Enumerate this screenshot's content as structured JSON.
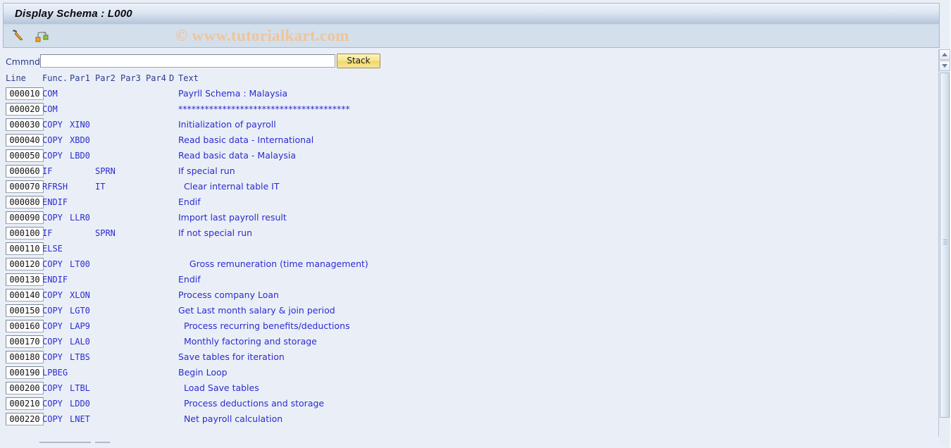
{
  "window": {
    "title": "Display Schema : L000"
  },
  "toolbar": {
    "icons": [
      {
        "name": "edit-pencil-icon",
        "label": "Display <-> Change"
      },
      {
        "name": "schema-structure-icon",
        "label": "Structure Display"
      }
    ]
  },
  "watermark": {
    "text": "© www.tutorialkart.com"
  },
  "command": {
    "label": "Cmmnd",
    "value": "",
    "placeholder": "",
    "stack_button": "Stack"
  },
  "table": {
    "headers": {
      "line": "Line",
      "func": "Func.",
      "par1": "Par1",
      "par2": "Par2",
      "par3": "Par3",
      "par4": "Par4",
      "d": "D",
      "text": "Text"
    },
    "rows": [
      {
        "line": "000010",
        "func": "COM",
        "par1": "",
        "par2": "",
        "par3": "",
        "par4": "",
        "d": "",
        "text": "Payrll Schema : Malaysia"
      },
      {
        "line": "000020",
        "func": "COM",
        "par1": "",
        "par2": "",
        "par3": "",
        "par4": "",
        "d": "",
        "text": "***************************************"
      },
      {
        "line": "000030",
        "func": "COPY",
        "par1": "XIN0",
        "par2": "",
        "par3": "",
        "par4": "",
        "d": "",
        "text": "Initialization of payroll"
      },
      {
        "line": "000040",
        "func": "COPY",
        "par1": "XBD0",
        "par2": "",
        "par3": "",
        "par4": "",
        "d": "",
        "text": "Read basic data - International"
      },
      {
        "line": "000050",
        "func": "COPY",
        "par1": "LBD0",
        "par2": "",
        "par3": "",
        "par4": "",
        "d": "",
        "text": "Read basic data - Malaysia"
      },
      {
        "line": "000060",
        "func": "IF",
        "par1": "",
        "par2": "SPRN",
        "par3": "",
        "par4": "",
        "d": "",
        "text": "If special run"
      },
      {
        "line": "000070",
        "func": "RFRSH",
        "par1": "",
        "par2": "IT",
        "par3": "",
        "par4": "",
        "d": "",
        "text": "  Clear internal table IT"
      },
      {
        "line": "000080",
        "func": "ENDIF",
        "par1": "",
        "par2": "",
        "par3": "",
        "par4": "",
        "d": "",
        "text": "Endif"
      },
      {
        "line": "000090",
        "func": "COPY",
        "par1": "LLR0",
        "par2": "",
        "par3": "",
        "par4": "",
        "d": "",
        "text": "Import last payroll result"
      },
      {
        "line": "000100",
        "func": "IF",
        "par1": "",
        "par2": "SPRN",
        "par3": "",
        "par4": "",
        "d": "",
        "text": "If not special run"
      },
      {
        "line": "000110",
        "func": "ELSE",
        "par1": "",
        "par2": "",
        "par3": "",
        "par4": "",
        "d": "",
        "text": ""
      },
      {
        "line": "000120",
        "func": "COPY",
        "par1": "LT00",
        "par2": "",
        "par3": "",
        "par4": "",
        "d": "",
        "text": "    Gross remuneration (time management)"
      },
      {
        "line": "000130",
        "func": "ENDIF",
        "par1": "",
        "par2": "",
        "par3": "",
        "par4": "",
        "d": "",
        "text": "Endif"
      },
      {
        "line": "000140",
        "func": "COPY",
        "par1": "XLON",
        "par2": "",
        "par3": "",
        "par4": "",
        "d": "",
        "text": "Process company Loan"
      },
      {
        "line": "000150",
        "func": "COPY",
        "par1": "LGT0",
        "par2": "",
        "par3": "",
        "par4": "",
        "d": "",
        "text": "Get Last month salary & join period"
      },
      {
        "line": "000160",
        "func": "COPY",
        "par1": "LAP9",
        "par2": "",
        "par3": "",
        "par4": "",
        "d": "",
        "text": "  Process recurring benefits/deductions"
      },
      {
        "line": "000170",
        "func": "COPY",
        "par1": "LAL0",
        "par2": "",
        "par3": "",
        "par4": "",
        "d": "",
        "text": "  Monthly factoring and storage"
      },
      {
        "line": "000180",
        "func": "COPY",
        "par1": "LTBS",
        "par2": "",
        "par3": "",
        "par4": "",
        "d": "",
        "text": "Save tables for iteration"
      },
      {
        "line": "000190",
        "func": "LPBEG",
        "par1": "",
        "par2": "",
        "par3": "",
        "par4": "",
        "d": "",
        "text": "Begin Loop"
      },
      {
        "line": "000200",
        "func": "COPY",
        "par1": "LTBL",
        "par2": "",
        "par3": "",
        "par4": "",
        "d": "",
        "text": "  Load Save tables"
      },
      {
        "line": "000210",
        "func": "COPY",
        "par1": "LDD0",
        "par2": "",
        "par3": "",
        "par4": "",
        "d": "",
        "text": "  Process deductions and storage"
      },
      {
        "line": "000220",
        "func": "COPY",
        "par1": "LNET",
        "par2": "",
        "par3": "",
        "par4": "",
        "d": "",
        "text": "  Net payroll calculation"
      }
    ]
  },
  "colors": {
    "text_blue": "#2b2bd0",
    "header_blue": "#2b3a8f",
    "accent_yellow": "#f1d865",
    "watermark": "#f0c49a",
    "canvas": "#eaeff7"
  }
}
